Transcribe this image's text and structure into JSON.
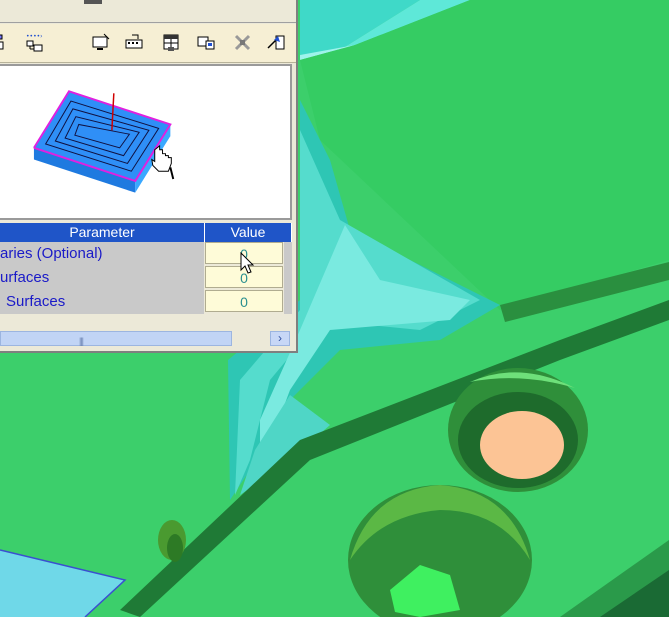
{
  "grid": {
    "headers": {
      "parameter": "Parameter",
      "value": "Value"
    },
    "rows": [
      {
        "parameter": "aries (Optional)",
        "value": "0"
      },
      {
        "parameter": "urfaces",
        "value": "0"
      },
      {
        "parameter": "Surfaces",
        "value": "0"
      }
    ]
  },
  "scrollbar": {
    "arrow_right": "›",
    "grip": "|||"
  },
  "toolbar": {
    "icons": [
      "blocks-icon",
      "tree-icon",
      "monitor-icon",
      "keyboard-icon",
      "table-icon",
      "display-icon",
      "tools-icon",
      "export-icon"
    ]
  },
  "colors": {
    "header_blue": "#1f55c8",
    "part_green": "#3ccf6b",
    "value_bg": "#fefbd8",
    "param_text": "#1a1ac8"
  }
}
